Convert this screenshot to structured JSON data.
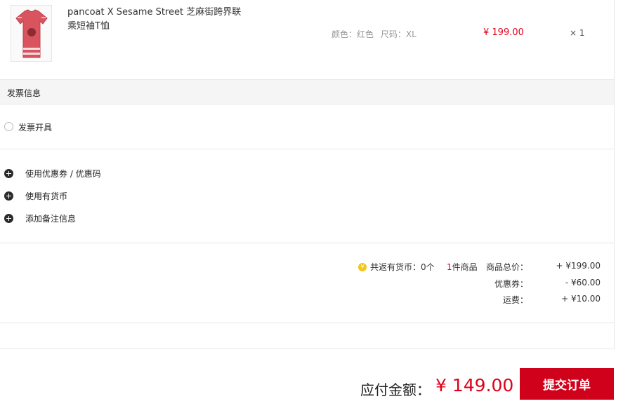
{
  "product": {
    "name": "pancoat X Sesame Street 芝麻街跨界联乘短袖T恤",
    "color_label": "颜色：红色",
    "size_label": "尺码：XL",
    "price": "¥ 199.00",
    "quantity": "× 1",
    "thumb_color": "#d9545f"
  },
  "invoice": {
    "title": "发票信息",
    "option_label": "发票开具"
  },
  "extras": [
    {
      "label": "使用优惠券 / 优惠码"
    },
    {
      "label": "使用有货币"
    },
    {
      "label": "添加备注信息"
    }
  ],
  "summary": {
    "coin_label": "共返有货币：0个",
    "item_count": "1",
    "item_count_suffix": "件商品",
    "rows": [
      {
        "label": "商品总价：",
        "value": "+ ¥199.00"
      },
      {
        "label": "优惠券：",
        "value": "- ¥60.00"
      },
      {
        "label": "运费：",
        "value": "+ ¥10.00"
      }
    ]
  },
  "footer": {
    "pay_label": "应付金额：",
    "pay_amount": "¥ 149.00",
    "submit_label": "提交订单"
  },
  "colors": {
    "accent_red": "#e0001a",
    "button_red": "#d0021b"
  }
}
